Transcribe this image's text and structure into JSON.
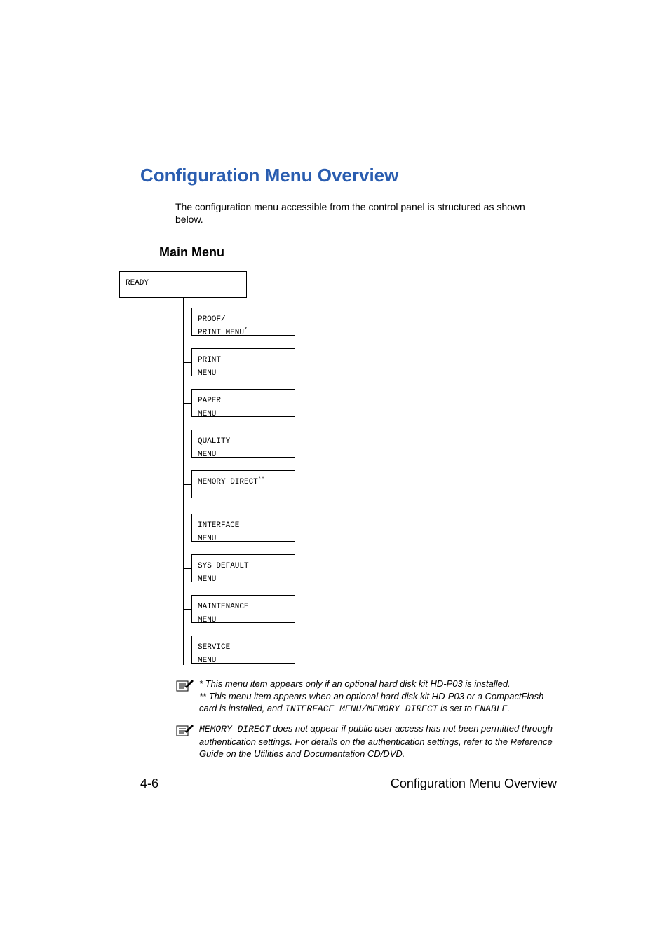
{
  "title": "Configuration Menu Overview",
  "intro": "The configuration menu accessible from the control panel is structured as shown below.",
  "subheading": "Main Menu",
  "diagram": {
    "root": "READY",
    "items": [
      {
        "line1": "PROOF/",
        "line2": "PRINT MENU",
        "sup": "*"
      },
      {
        "line1": "PRINT",
        "line2": "MENU",
        "sup": ""
      },
      {
        "line1": "PAPER",
        "line2": "MENU",
        "sup": ""
      },
      {
        "line1": "QUALITY",
        "line2": "MENU",
        "sup": ""
      },
      {
        "line1": "MEMORY DIRECT",
        "line2": "",
        "sup": "**"
      },
      {
        "line1": "INTERFACE",
        "line2": "MENU",
        "sup": ""
      },
      {
        "line1": "SYS DEFAULT",
        "line2": "MENU",
        "sup": ""
      },
      {
        "line1": "MAINTENANCE",
        "line2": "MENU",
        "sup": ""
      },
      {
        "line1": "SERVICE",
        "line2": "MENU",
        "sup": ""
      }
    ]
  },
  "notes": {
    "n1_a": "* This menu item appears only if an optional hard disk kit HD-P03 is installed.",
    "n1_b": "** This menu item appears when an optional hard disk kit HD-P03 or a CompactFlash card is installed, and  ",
    "n1_c_mono": "INTERFACE MENU/MEMORY DIRECT",
    "n1_d": "  is set to ",
    "n1_e_mono": "ENABLE",
    "n1_f": ".",
    "n2_a_mono": "MEMORY DIRECT",
    "n2_b": " does not appear if public user access has not been permitted through authentication settings. For details on the authentication settings, refer to the Reference Guide on the Utilities and Documentation CD/DVD."
  },
  "footer": {
    "page": "4-6",
    "section": "Configuration Menu Overview"
  }
}
